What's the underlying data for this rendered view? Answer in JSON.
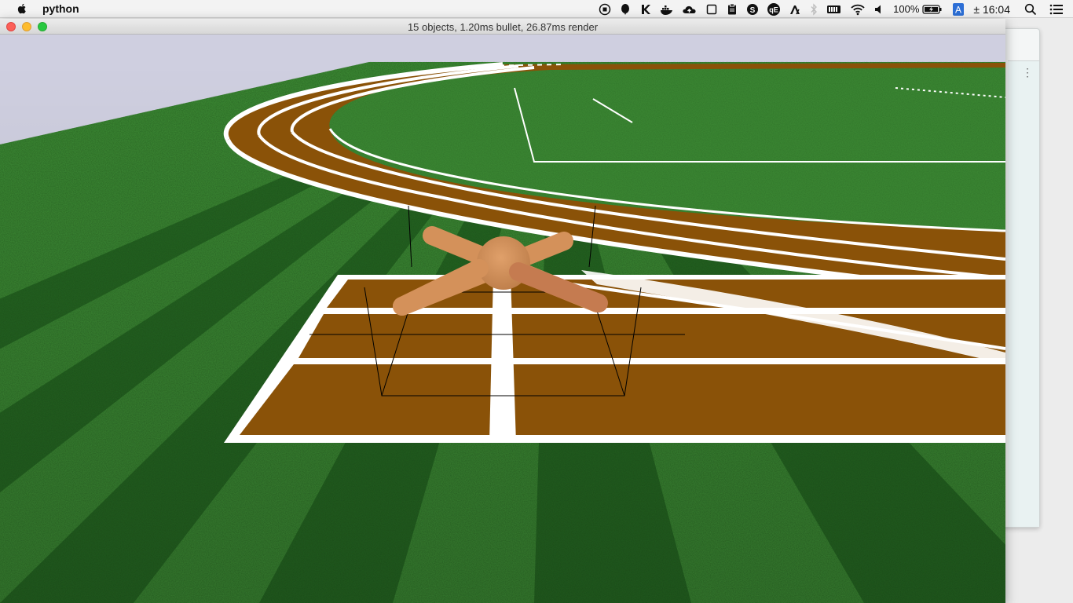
{
  "menubar": {
    "app_name": "python",
    "battery": "100%",
    "input_source": "A",
    "clock": "± 16:04",
    "icons": [
      "record-icon",
      "balloon-icon",
      "k-app-icon",
      "docker-icon",
      "cloud-upload-icon",
      "window-icon",
      "clipboard-icon",
      "skype-icon",
      "qe-icon",
      "a-app-icon",
      "bluetooth-icon",
      "battery-status-icon",
      "wifi-icon",
      "volume-icon",
      "battery-icon",
      "input-source-icon",
      "search-icon",
      "menu-list-icon"
    ]
  },
  "window": {
    "title": "15 objects, 1.20ms bullet, 26.87ms render"
  },
  "scene": {
    "sky_color": "#cfcfe0",
    "grass_light": "#3d8a35",
    "grass_dark": "#1e5a1c",
    "track_color": "#8a5208",
    "line_color": "#ffffff",
    "agent_color": "#d4915a"
  }
}
